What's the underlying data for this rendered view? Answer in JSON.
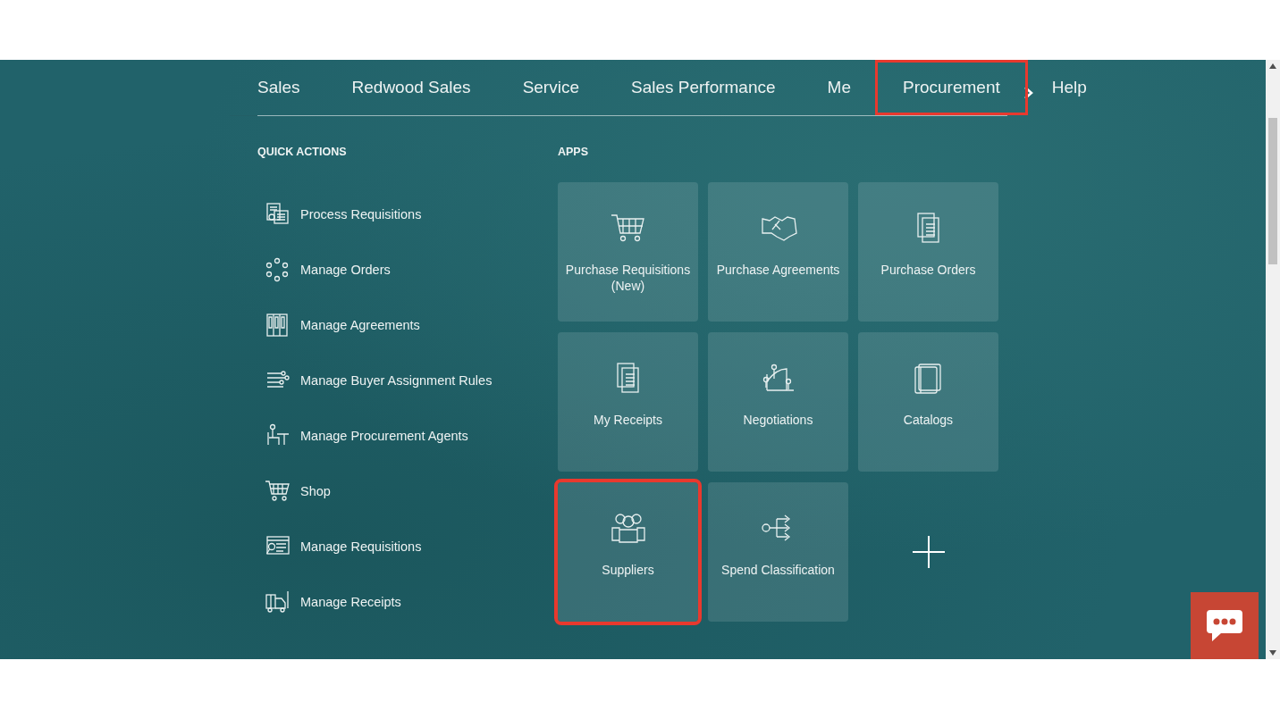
{
  "nav": {
    "tabs": [
      {
        "label": "Sales",
        "highlighted": false
      },
      {
        "label": "Redwood Sales",
        "highlighted": false
      },
      {
        "label": "Service",
        "highlighted": false
      },
      {
        "label": "Sales Performance",
        "highlighted": false
      },
      {
        "label": "Me",
        "highlighted": false
      },
      {
        "label": "Procurement",
        "highlighted": true
      },
      {
        "label": "Help",
        "highlighted": false
      }
    ]
  },
  "quick_actions": {
    "heading": "QUICK ACTIONS",
    "items": [
      {
        "label": "Process Requisitions"
      },
      {
        "label": "Manage Orders"
      },
      {
        "label": "Manage Agreements"
      },
      {
        "label": "Manage Buyer Assignment Rules"
      },
      {
        "label": "Manage Procurement Agents"
      },
      {
        "label": "Shop"
      },
      {
        "label": "Manage Requisitions"
      },
      {
        "label": "Manage Receipts"
      }
    ]
  },
  "apps": {
    "heading": "APPS",
    "tiles": [
      {
        "label": "Purchase Requisitions (New)",
        "highlighted": false
      },
      {
        "label": "Purchase Agreements",
        "highlighted": false
      },
      {
        "label": "Purchase Orders",
        "highlighted": false
      },
      {
        "label": "My Receipts",
        "highlighted": false
      },
      {
        "label": "Negotiations",
        "highlighted": false
      },
      {
        "label": "Catalogs",
        "highlighted": false
      },
      {
        "label": "Suppliers",
        "highlighted": true
      },
      {
        "label": "Spend Classification",
        "highlighted": false
      }
    ]
  }
}
